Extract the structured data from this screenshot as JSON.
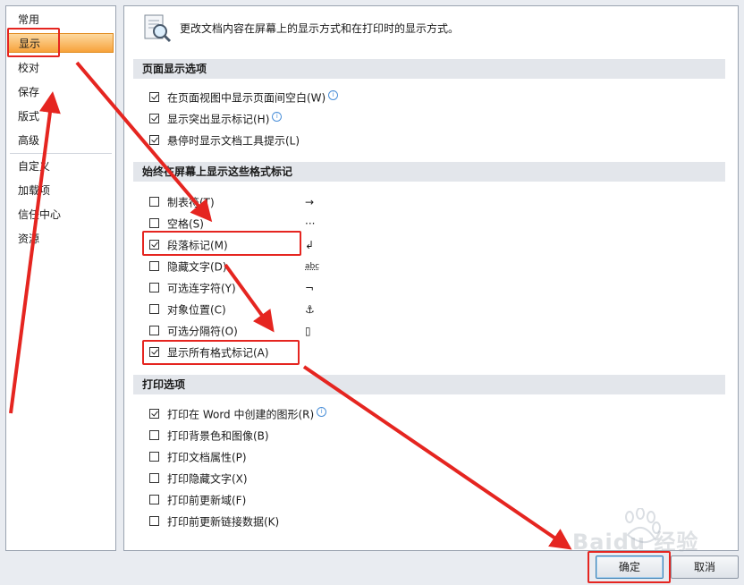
{
  "sidebar": {
    "items": [
      {
        "label": "常用"
      },
      {
        "label": "显示"
      },
      {
        "label": "校对"
      },
      {
        "label": "保存"
      },
      {
        "label": "版式"
      },
      {
        "label": "高级"
      },
      {
        "label": "自定义"
      },
      {
        "label": "加载项"
      },
      {
        "label": "信任中心"
      },
      {
        "label": "资源"
      }
    ],
    "selected": "显示"
  },
  "header": {
    "text": "更改文档内容在屏幕上的显示方式和在打印时的显示方式。"
  },
  "sections": {
    "page_display": {
      "title": "页面显示选项",
      "options": [
        {
          "label": "在页面视图中显示页面间空白(W)",
          "checked": true,
          "info": true
        },
        {
          "label": "显示突出显示标记(H)",
          "checked": true,
          "info": true
        },
        {
          "label": "悬停时显示文档工具提示(L)",
          "checked": true,
          "info": false
        }
      ]
    },
    "format_marks": {
      "title": "始终在屏幕上显示这些格式标记",
      "options": [
        {
          "label": "制表符(T)",
          "checked": false,
          "symbol": "→"
        },
        {
          "label": "空格(S)",
          "checked": false,
          "symbol": "···"
        },
        {
          "label": "段落标记(M)",
          "checked": true,
          "symbol": "↲"
        },
        {
          "label": "隐藏文字(D)",
          "checked": false,
          "symbol": "abc"
        },
        {
          "label": "可选连字符(Y)",
          "checked": false,
          "symbol": "¬"
        },
        {
          "label": "对象位置(C)",
          "checked": false,
          "symbol": "⚓"
        },
        {
          "label": "可选分隔符(O)",
          "checked": false,
          "symbol": "▯"
        },
        {
          "label": "显示所有格式标记(A)",
          "checked": true,
          "symbol": ""
        }
      ]
    },
    "print": {
      "title": "打印选项",
      "options": [
        {
          "label": "打印在 Word 中创建的图形(R)",
          "checked": true,
          "info": true
        },
        {
          "label": "打印背景色和图像(B)",
          "checked": false,
          "info": false
        },
        {
          "label": "打印文档属性(P)",
          "checked": false,
          "info": false
        },
        {
          "label": "打印隐藏文字(X)",
          "checked": false,
          "info": false
        },
        {
          "label": "打印前更新域(F)",
          "checked": false,
          "info": false
        },
        {
          "label": "打印前更新链接数据(K)",
          "checked": false,
          "info": false
        }
      ]
    }
  },
  "buttons": {
    "ok": "确定",
    "cancel": "取消"
  },
  "watermark": {
    "text": "Baidu 经验"
  },
  "colors": {
    "annotation_red": "#e52520",
    "selected_nav": "#f7a23b",
    "section_bg": "#e3e6eb"
  }
}
